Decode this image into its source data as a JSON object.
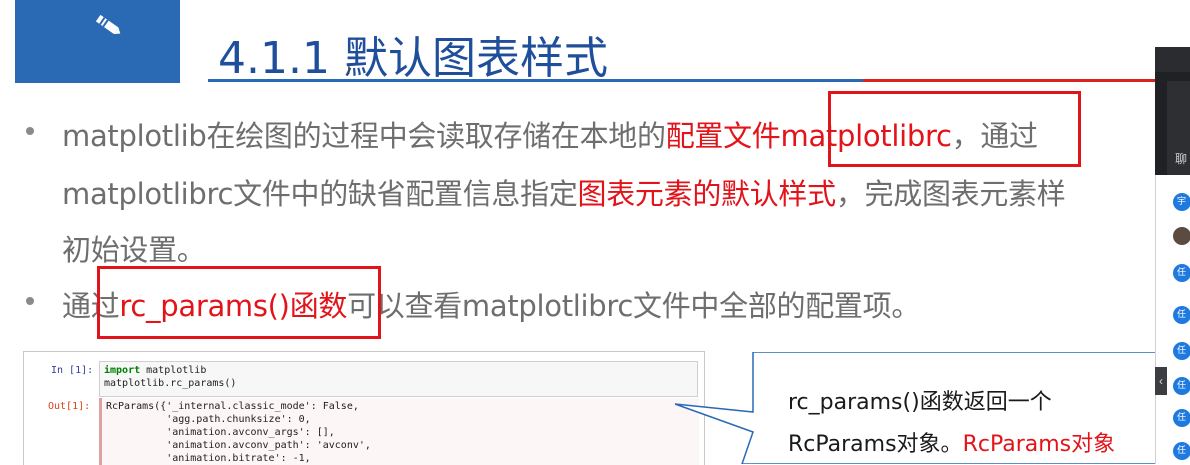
{
  "slide": {
    "title": "4.1.1 默认图表样式",
    "bullets": [
      {
        "line1": [
          {
            "text": "matplotlib在绘图的过程中会读取存储在本地的",
            "red": false
          },
          {
            "text": "配置文件matplotlibrc",
            "red": true
          },
          {
            "text": "，通过",
            "red": false
          }
        ],
        "line2": [
          {
            "text": "matplotlibrc文件中的缺省配置信息指定",
            "red": false
          },
          {
            "text": "图表元素的默认样式",
            "red": true
          },
          {
            "text": "，完成图表元素样",
            "red": false
          }
        ],
        "line3": [
          {
            "text": "初始设置。",
            "red": false
          }
        ]
      },
      {
        "line1": [
          {
            "text": "通过",
            "red": false
          },
          {
            "text": "rc_params()函数",
            "red": true
          },
          {
            "text": "可以查看matplotlibrc文件中全部的配置项。",
            "red": false
          }
        ]
      }
    ],
    "accent_blue": "#2a6ab5",
    "accent_red": "#e3131a"
  },
  "notebook": {
    "in_prompt": "In [1]:",
    "in_lines": [
      {
        "kw": "import",
        "rest": " matplotlib"
      },
      {
        "kw": "",
        "rest": "matplotlib.rc_params()"
      }
    ],
    "out_prompt": "Out[1]:",
    "out_lines": [
      "RcParams({'_internal.classic_mode': False,",
      "          'agg.path.chunksize': 0,",
      "          'animation.avconv_args': [],",
      "          'animation.avconv_path': 'avconv',",
      "          'animation.bitrate': -1,"
    ]
  },
  "callout": {
    "line1": "rc_params()函数返回一个",
    "line2_black": "RcParams对象。",
    "line2_red": "RcParams对象"
  },
  "sidebar": {
    "label": "聊",
    "avatars": [
      "宇",
      "",
      "任",
      "任",
      "任",
      "任",
      "任",
      "任",
      "任"
    ]
  }
}
